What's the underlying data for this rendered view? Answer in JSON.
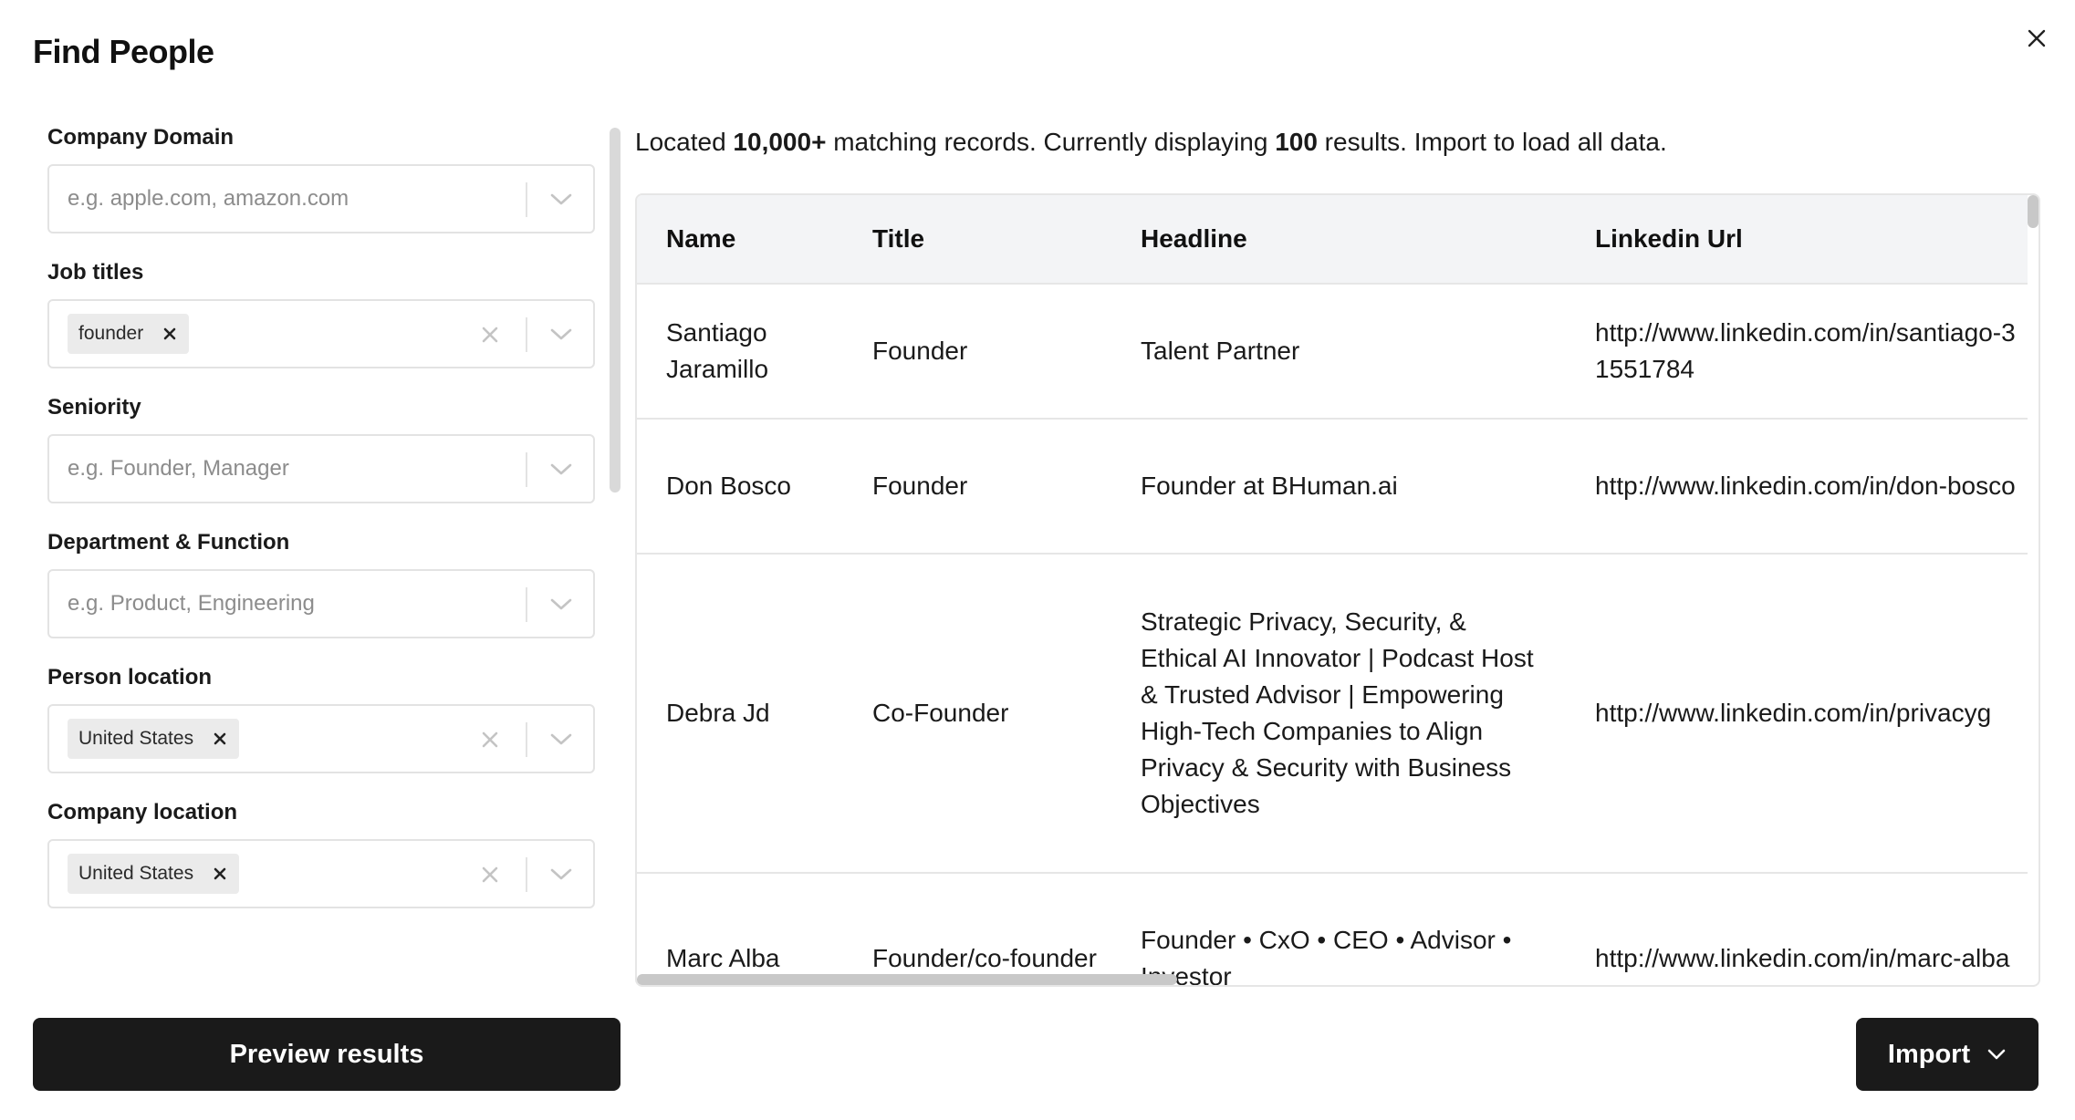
{
  "dialog": {
    "title": "Find People"
  },
  "filters": [
    {
      "label": "Company Domain",
      "placeholder": "e.g. apple.com, amazon.com",
      "tags": []
    },
    {
      "label": "Job titles",
      "placeholder": "",
      "tags": [
        "founder"
      ]
    },
    {
      "label": "Seniority",
      "placeholder": "e.g. Founder, Manager",
      "tags": []
    },
    {
      "label": "Department & Function",
      "placeholder": "e.g. Product, Engineering",
      "tags": []
    },
    {
      "label": "Person location",
      "placeholder": "",
      "tags": [
        "United States"
      ]
    },
    {
      "label": "Company location",
      "placeholder": "",
      "tags": [
        "United States"
      ]
    }
  ],
  "summary": {
    "prefix": "Located ",
    "total": "10,000+",
    "middle": " matching records. Currently displaying ",
    "shown": "100",
    "suffix": " results. Import to load all data."
  },
  "table": {
    "columns": [
      "Name",
      "Title",
      "Headline",
      "Linkedin Url"
    ],
    "rows": [
      {
        "name": "Santiago Jaramillo",
        "title": "Founder",
        "headline": "Talent Partner",
        "linkedin": "http://www.linkedin.com/in/santiago-31551784"
      },
      {
        "name": "Don Bosco",
        "title": "Founder",
        "headline": "Founder at BHuman.ai",
        "linkedin": "http://www.linkedin.com/in/don-bosco"
      },
      {
        "name": "Debra Jd",
        "title": "Co-Founder",
        "headline": "Strategic Privacy, Security, & Ethical AI Innovator | Podcast Host & Trusted Advisor | Empowering High-Tech Companies to Align Privacy & Security with Business Objectives",
        "linkedin": "http://www.linkedin.com/in/privacyg"
      },
      {
        "name": "Marc Alba",
        "title": "Founder/co-founder",
        "headline": "Founder • CxO • CEO • Advisor • Investor",
        "linkedin": "http://www.linkedin.com/in/marc-alba"
      }
    ]
  },
  "buttons": {
    "preview": "Preview results",
    "import": "Import"
  },
  "icons": {
    "close": "close-icon",
    "dropdown": "chevron-down-icon",
    "clear": "clear-icon",
    "tag_remove": "tag-remove-icon"
  }
}
